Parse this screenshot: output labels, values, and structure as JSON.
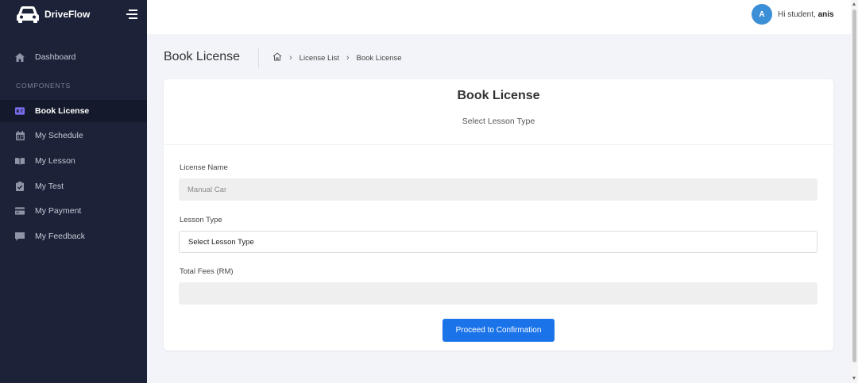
{
  "app": {
    "name": "DriveFlow"
  },
  "sidebar": {
    "section_title": "COMPONENTS",
    "items": [
      {
        "label": "Dashboard",
        "icon": "home-icon"
      },
      {
        "label": "Book License",
        "icon": "id-card-icon",
        "active": true
      },
      {
        "label": "My Schedule",
        "icon": "calendar-icon"
      },
      {
        "label": "My Lesson",
        "icon": "book-icon"
      },
      {
        "label": "My Test",
        "icon": "clipboard-check-icon"
      },
      {
        "label": "My Payment",
        "icon": "credit-card-icon"
      },
      {
        "label": "My Feedback",
        "icon": "comment-icon"
      }
    ]
  },
  "topbar": {
    "avatar_initial": "A",
    "greeting": "Hi student,",
    "username": "anis"
  },
  "page": {
    "title": "Book License",
    "breadcrumb": [
      "License List",
      "Book License"
    ]
  },
  "form": {
    "title": "Book License",
    "subtitle": "Select Lesson Type",
    "license_name_label": "License Name",
    "license_name_value": "Manual Car",
    "lesson_type_label": "Lesson Type",
    "lesson_type_value": "Select Lesson Type",
    "total_fees_label": "Total Fees (RM)",
    "total_fees_value": "",
    "submit_label": "Proceed to Confirmation"
  },
  "colors": {
    "sidebar_bg": "#1c2237",
    "accent": "#1a73e8",
    "active_icon": "#7a6ff0",
    "avatar": "#3b8fd6"
  }
}
